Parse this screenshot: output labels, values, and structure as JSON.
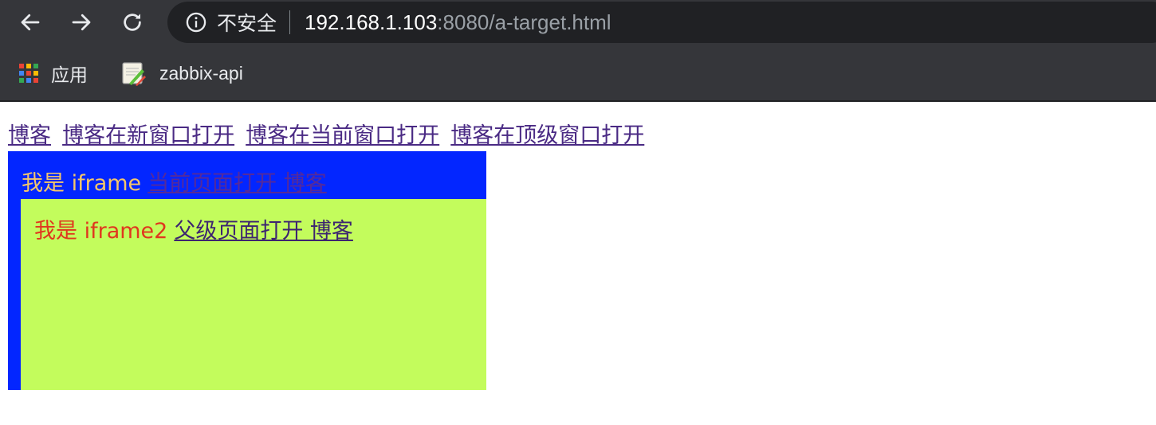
{
  "browser": {
    "security_label": "不安全",
    "url_host": "192.168.1.103",
    "url_rest": ":8080/a-target.html",
    "icons": {
      "back": "arrow-left-icon",
      "forward": "arrow-right-icon",
      "reload": "reload-icon",
      "security": "info-icon"
    },
    "colors": {
      "toolbar_bg": "#35363a",
      "omnibox_bg": "#202124"
    }
  },
  "bookmarks": [
    {
      "label": "应用",
      "icon": "apps-grid-icon"
    },
    {
      "label": "zabbix-api",
      "icon": "notebook-icon"
    }
  ],
  "page": {
    "links": [
      "博客",
      "博客在新窗口打开",
      "博客在当前窗口打开",
      "博客在顶级窗口打开"
    ],
    "iframe1": {
      "text": "我是 iframe",
      "link": "当前页面打开 博客",
      "bg_color": "#0326ff"
    },
    "iframe2": {
      "text": "我是 iframe2",
      "link": "父级页面打开 博客",
      "bg_color": "#c3fc5c"
    }
  }
}
